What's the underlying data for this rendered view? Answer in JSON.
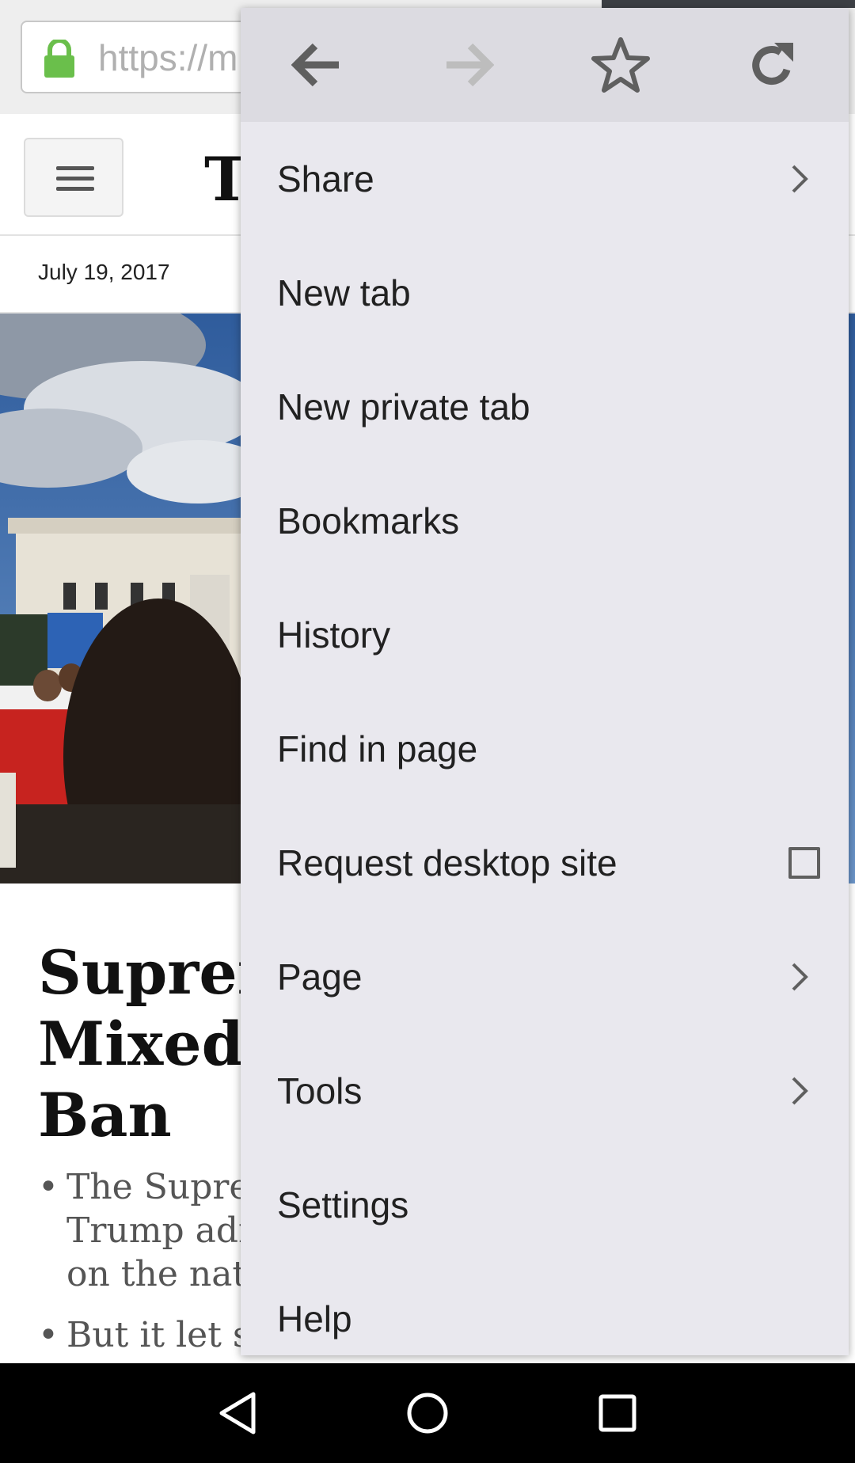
{
  "browser": {
    "url_text": "https://m"
  },
  "site": {
    "logo": "T",
    "date": "July 19, 2017",
    "headline_lines": [
      "Supren",
      "Mixed",
      "Ban"
    ],
    "bullets": [
      [
        "The Supren",
        "Trump adr",
        "on the nati"
      ],
      [
        "But it let st"
      ]
    ]
  },
  "menu": {
    "toolbar": [
      "back-icon",
      "forward-icon",
      "star-icon",
      "refresh-icon"
    ],
    "items": [
      {
        "label": "Share",
        "trailing": "chevron"
      },
      {
        "label": "New tab",
        "trailing": ""
      },
      {
        "label": "New private tab",
        "trailing": ""
      },
      {
        "label": "Bookmarks",
        "trailing": ""
      },
      {
        "label": "History",
        "trailing": ""
      },
      {
        "label": "Find in page",
        "trailing": ""
      },
      {
        "label": "Request desktop site",
        "trailing": "checkbox",
        "checked": false
      },
      {
        "label": "Page",
        "trailing": "chevron"
      },
      {
        "label": "Tools",
        "trailing": "chevron"
      },
      {
        "label": "Settings",
        "trailing": ""
      },
      {
        "label": "Help",
        "trailing": ""
      }
    ]
  },
  "navbar": [
    "back-triangle-icon",
    "home-circle-icon",
    "recents-square-icon"
  ],
  "colors": {
    "menu_bg": "#e9e8ee",
    "toolbar_bg": "#dcdbe1",
    "lock": "#6abf4b",
    "icon_dark": "#5f5f5f",
    "icon_disabled": "#bdbdbd"
  }
}
